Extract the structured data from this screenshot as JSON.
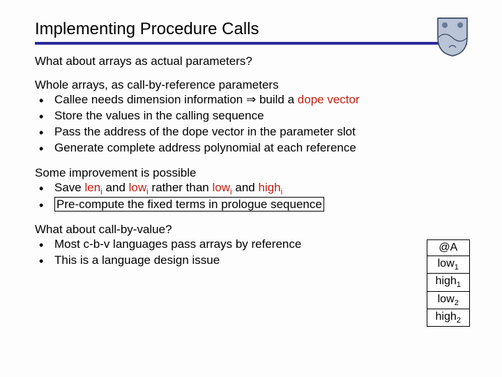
{
  "title": "Implementing Procedure Calls",
  "lead": "What about arrays as actual parameters?",
  "section1_head": "Whole arrays, as call-by-reference parameters",
  "b1": {
    "a_pre": "Callee needs dimension information ",
    "arrow": "⇒",
    "a_mid": " build a ",
    "dope": "dope vector",
    "b": "Store the values in the calling sequence",
    "c": "Pass the address of the dope vector in the parameter slot",
    "d": "Generate complete address polynomial at each reference"
  },
  "section2_head": "Some improvement is possible",
  "b2": {
    "a_pre": "Save ",
    "len": "len",
    "sub_i": "i",
    "and": " and ",
    "low": "low",
    "rather": " rather than ",
    "high": "high",
    "b": "Pre-compute the fixed terms in prologue sequence"
  },
  "section3_head": "What about call-by-value?",
  "b3": {
    "a": "Most c-b-v languages pass arrays by reference",
    "b": "This is a language design issue"
  },
  "table": {
    "r0": "@A",
    "r1_base": "low",
    "r1_sub": "1",
    "r2_base": "high",
    "r2_sub": "1",
    "r3_base": "low",
    "r3_sub": "2",
    "r4_base": "high",
    "r4_sub": "2"
  }
}
